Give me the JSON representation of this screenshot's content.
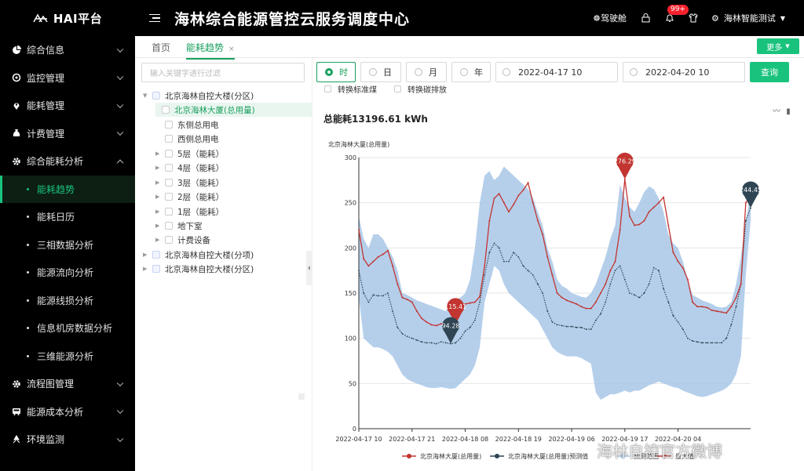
{
  "app": {
    "logo_text": "HAI平台",
    "title": "海林综合能源管控云服务调度中心",
    "cabin_label": "驾驶舱",
    "notification_count": "99+",
    "user_name": "海林智能测试"
  },
  "sidebar": {
    "items": [
      {
        "label": "综合信息",
        "icon": "pie-icon"
      },
      {
        "label": "监控管理",
        "icon": "monitor-icon"
      },
      {
        "label": "能耗管理",
        "icon": "location-icon"
      },
      {
        "label": "计费管理",
        "icon": "money-bag-icon"
      },
      {
        "label": "综合能耗分析",
        "icon": "gear-icon",
        "expanded": true
      }
    ],
    "sub_items": [
      {
        "label": "能耗趋势",
        "active": true
      },
      {
        "label": "能耗日历"
      },
      {
        "label": "三相数据分析"
      },
      {
        "label": "能源流向分析"
      },
      {
        "label": "能源线损分析"
      },
      {
        "label": "信息机房数据分析"
      },
      {
        "label": "三维能源分析"
      }
    ],
    "bottom_items": [
      {
        "label": "流程图管理",
        "icon": "gear-icon"
      },
      {
        "label": "能源成本分析",
        "icon": "bus-icon"
      },
      {
        "label": "环境监测",
        "icon": "recycle-icon"
      }
    ]
  },
  "tabs": {
    "home": "首页",
    "active": "能耗趋势",
    "close": "×",
    "more": "更多"
  },
  "tree": {
    "search_placeholder": "输入关键字进行过滤",
    "nodes": [
      {
        "label": "北京海林自控大楼(分区)",
        "level": 0,
        "expand": "▼"
      },
      {
        "label": "北京海林大厦(总用量)",
        "level": 1,
        "selected": true
      },
      {
        "label": "东侧总用电",
        "level": 1
      },
      {
        "label": "西侧总用电",
        "level": 1
      },
      {
        "label": "5层（能耗）",
        "level": 1,
        "expand": "▶"
      },
      {
        "label": "4层（能耗）",
        "level": 1,
        "expand": "▶"
      },
      {
        "label": "3层（能耗）",
        "level": 1,
        "expand": "▶"
      },
      {
        "label": "2层（能耗）",
        "level": 1,
        "expand": "▶"
      },
      {
        "label": "1层（能耗）",
        "level": 1,
        "expand": "▶"
      },
      {
        "label": "地下室",
        "level": 1,
        "expand": "▶"
      },
      {
        "label": "计费设备",
        "level": 1,
        "expand": "▶"
      },
      {
        "label": "北京海林自控大楼(分项)",
        "level": 0,
        "expand": "▶"
      },
      {
        "label": "北京海林自控大楼(分区)",
        "level": 0,
        "expand": "▶"
      }
    ]
  },
  "filters": {
    "granularity": [
      "时",
      "日",
      "月",
      "年"
    ],
    "start": "2022-04-17 10",
    "end": "2022-04-20 10",
    "query": "查询",
    "convert_coal": "转换标准煤",
    "convert_carbon": "转换碳排放"
  },
  "total_label": "总能耗13196.61 kWh",
  "watermark": "海林自控官方微博",
  "chart_data": {
    "type": "line",
    "ylabel": "北京海林大厦(总用量)",
    "ylim": [
      0,
      300
    ],
    "yticks": [
      0,
      50,
      100,
      150,
      200,
      250,
      300
    ],
    "xtick_labels": [
      "2022-04-17 10",
      "2022-04-17 21",
      "2022-04-18 08",
      "2022-04-18 19",
      "2022-04-19 06",
      "2022-04-19 17",
      "2022-04-20 04"
    ],
    "markers": [
      {
        "label": "115.41",
        "value": 115.41,
        "series": "actual",
        "x": 20
      },
      {
        "label": "94.28",
        "value": 94.28,
        "series": "forecast",
        "x": 19
      },
      {
        "label": "276.29",
        "value": 276.29,
        "series": "actual",
        "x": 55
      },
      {
        "label": "244.45",
        "value": 244.45,
        "series": "forecast",
        "x": 81
      }
    ],
    "legend": [
      {
        "name": "北京海林大厦(总用量)",
        "color": "#c23531"
      },
      {
        "name": "北京海林大厦(总用量)预测值",
        "color": "#2f4554"
      },
      {
        "name": "预测范围",
        "color": "#a8c7e8"
      },
      {
        "name": "最大值",
        "color": "#c23531"
      }
    ],
    "series": [
      {
        "name": "北京海林大厦(总用量)",
        "color": "#c23531",
        "values": [
          220,
          188,
          180,
          185,
          190,
          193,
          197,
          180,
          160,
          145,
          143,
          140,
          130,
          122,
          118,
          115,
          114,
          116,
          115,
          116,
          115,
          130,
          138,
          139,
          140,
          146,
          180,
          230,
          255,
          260,
          250,
          240,
          248,
          258,
          264,
          272,
          250,
          230,
          215,
          190,
          170,
          150,
          145,
          142,
          140,
          138,
          135,
          133,
          133,
          140,
          150,
          160,
          175,
          185,
          220,
          276,
          235,
          225,
          226,
          230,
          240,
          245,
          250,
          256,
          225,
          195,
          185,
          178,
          165,
          140,
          135,
          135,
          134,
          131,
          130,
          129,
          128,
          135,
          145,
          160,
          250,
          258
        ]
      },
      {
        "name": "北京海林大厦(总用量)预测值",
        "color": "#2f4554",
        "values": [
          175,
          150,
          140,
          148,
          147,
          147,
          150,
          130,
          112,
          105,
          102,
          100,
          98,
          96,
          95,
          95,
          94,
          96,
          95,
          94,
          95,
          100,
          108,
          112,
          120,
          140,
          170,
          195,
          205,
          200,
          185,
          185,
          195,
          190,
          180,
          175,
          170,
          160,
          150,
          130,
          118,
          115,
          114,
          113,
          113,
          112,
          112,
          110,
          110,
          120,
          127,
          140,
          160,
          175,
          180,
          165,
          150,
          148,
          145,
          150,
          160,
          178,
          175,
          155,
          140,
          125,
          118,
          110,
          100,
          97,
          96,
          95,
          95,
          95,
          95,
          95,
          100,
          115,
          135,
          160,
          230,
          244
        ]
      },
      {
        "name": "预测范围_upper",
        "color": "#a8c7e8",
        "values": [
          235,
          210,
          200,
          215,
          215,
          210,
          200,
          190,
          175,
          150,
          148,
          145,
          142,
          140,
          138,
          136,
          134,
          132,
          130,
          140,
          142,
          145,
          150,
          165,
          200,
          250,
          280,
          285,
          275,
          280,
          290,
          285,
          280,
          275,
          270,
          265,
          255,
          240,
          225,
          200,
          185,
          165,
          158,
          155,
          150,
          148,
          146,
          145,
          150,
          160,
          175,
          190,
          210,
          225,
          270,
          255,
          245,
          240,
          250,
          262,
          268,
          265,
          255,
          240,
          215,
          205,
          200,
          185,
          165,
          148,
          145,
          142,
          140,
          138,
          135,
          134,
          135,
          140,
          160,
          190,
          230,
          260
        ]
      },
      {
        "name": "预测范围_lower",
        "color": "#a8c7e8",
        "values": [
          145,
          100,
          95,
          90,
          90,
          88,
          85,
          80,
          70,
          60,
          55,
          52,
          50,
          48,
          46,
          45,
          45,
          46,
          45,
          44,
          45,
          50,
          55,
          60,
          70,
          90,
          140,
          160,
          180,
          175,
          160,
          150,
          145,
          140,
          135,
          130,
          125,
          120,
          110,
          100,
          90,
          85,
          82,
          80,
          80,
          80,
          78,
          75,
          72,
          40,
          32,
          35,
          38,
          38,
          40,
          42,
          40,
          42,
          42,
          45,
          48,
          50,
          52,
          50,
          48,
          46,
          45,
          42,
          40,
          38,
          36,
          35,
          36,
          38,
          40,
          42,
          45,
          50,
          60,
          80,
          170,
          230
        ]
      }
    ]
  }
}
